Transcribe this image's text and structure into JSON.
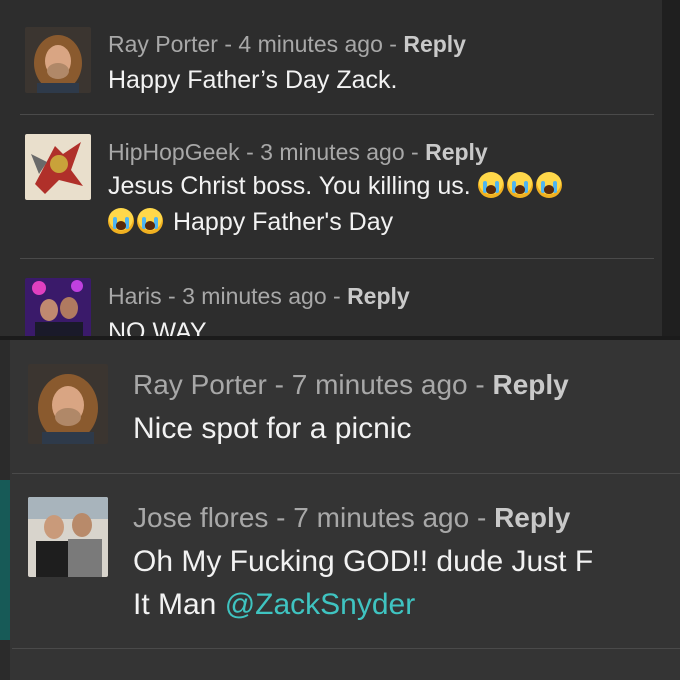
{
  "top_screenshot": {
    "comments": [
      {
        "author": "Ray Porter",
        "separator": " - ",
        "time": "4 minutes ago",
        "dash": " - ",
        "reply_label": "Reply",
        "text": "Happy Father’s Day Zack."
      },
      {
        "author": "HipHopGeek",
        "separator": " - ",
        "time": "3 minutes ago",
        "dash": " - ",
        "reply_label": "Reply",
        "text_line1": "Jesus Christ boss. You killing us.",
        "text_line2": "Happy Father's Day",
        "emoji_name": "loudly-crying-face-emoji"
      },
      {
        "author": "Haris",
        "separator": " - ",
        "time": "3 minutes ago",
        "dash": " - ",
        "reply_label": "Reply",
        "text": "NO WAY"
      }
    ]
  },
  "bottom_screenshot": {
    "comments": [
      {
        "author": "Ray Porter",
        "separator": " - ",
        "time": "7 minutes ago",
        "dash": " - ",
        "reply_label": "Reply",
        "text": "Nice spot for a picnic"
      },
      {
        "author": "Jose flores",
        "separator": " - ",
        "time": "7 minutes ago",
        "dash": " - ",
        "reply_label": "Reply",
        "text_line1": "Oh My Fucking GOD!!  dude Just F",
        "text_line2_prefix": "It Man ",
        "mention": "@ZackSnyder"
      }
    ]
  },
  "colors": {
    "background_top": "#2d2d2d",
    "background_bottom": "#343434",
    "meta_text": "#a8a8a8",
    "body_text": "#f2f2f2",
    "mention": "#3fc4c1"
  }
}
